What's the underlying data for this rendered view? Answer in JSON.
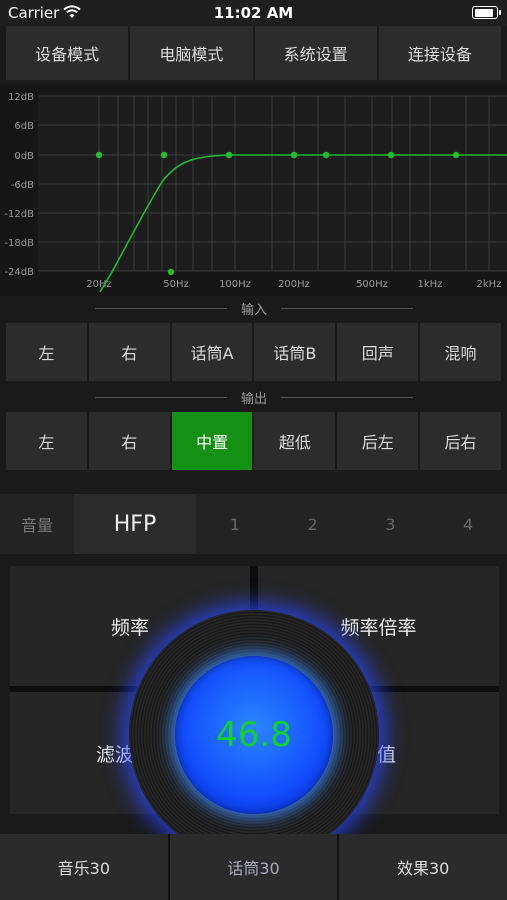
{
  "status_bar": {
    "carrier": "Carrier",
    "time": "11:02 AM",
    "battery_level": 0.9
  },
  "top_tabs": [
    "设备模式",
    "电脑模式",
    "系统设置",
    "连接设备"
  ],
  "eq": {
    "db_labels": [
      "12dB",
      "6dB",
      "0dB",
      "-6dB",
      "-12dB",
      "-18dB",
      "-24dB"
    ],
    "freq_labels": [
      "20Hz",
      "50Hz",
      "100Hz",
      "200Hz",
      "500Hz",
      "1kHz",
      "2kHz"
    ],
    "curve_color": "#1fbf2a"
  },
  "input": {
    "title": "输入",
    "buttons": [
      "左",
      "右",
      "话筒A",
      "话筒B",
      "回声",
      "混响"
    ]
  },
  "output": {
    "title": "输出",
    "buttons": [
      "左",
      "右",
      "中置",
      "超低",
      "后左",
      "后右"
    ],
    "active_index": 2,
    "active_color": "#149014"
  },
  "selector": {
    "volume_label": "音量",
    "selected": "HFP",
    "numbers": [
      "1",
      "2",
      "3",
      "4"
    ]
  },
  "params": {
    "frequency": "频率",
    "frequency_multiplier": "频率倍率",
    "filter_partial": "滤波",
    "value_partial": "值"
  },
  "knob": {
    "value": "46.8",
    "color": "#1452ff",
    "text_color": "#12d22a"
  },
  "presets": [
    "音乐30",
    "话筒30",
    "效果30"
  ]
}
